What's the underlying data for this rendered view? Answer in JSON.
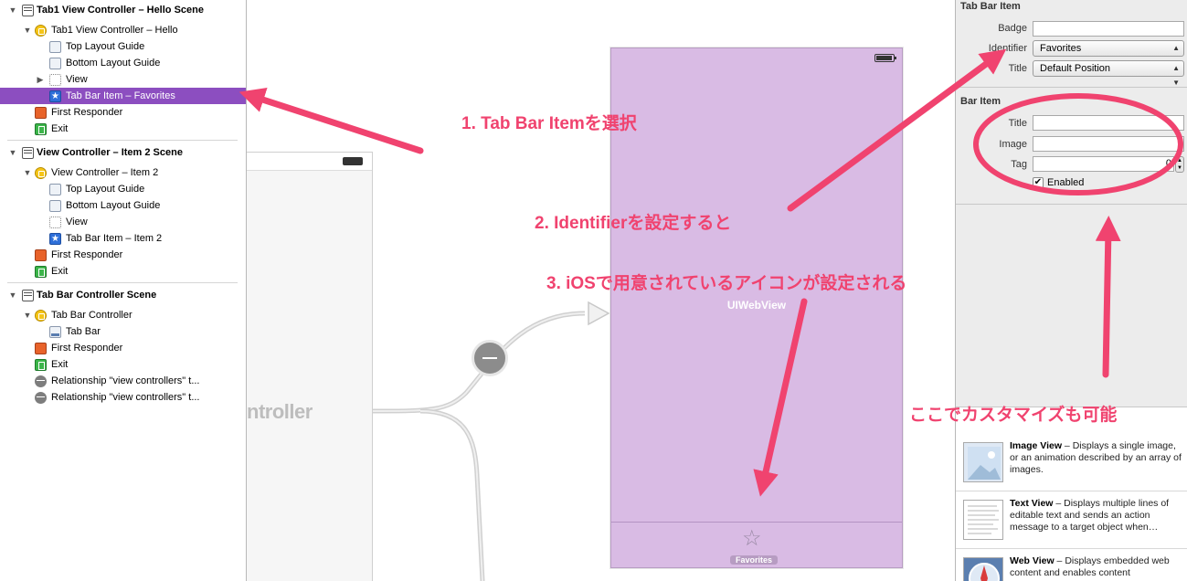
{
  "outline": {
    "items": [
      {
        "label": "Tab1 View Controller – Hello Scene",
        "icon": "scene-icon"
      },
      {
        "label": "Tab1 View Controller – Hello",
        "icon": "view-controller-icon"
      },
      {
        "label": "Top Layout Guide",
        "icon": "layout-guide-icon"
      },
      {
        "label": "Bottom Layout Guide",
        "icon": "layout-guide-icon"
      },
      {
        "label": "View",
        "icon": "view-icon"
      },
      {
        "label": "Tab Bar Item – Favorites",
        "icon": "tab-bar-item-icon"
      },
      {
        "label": "First Responder",
        "icon": "first-responder-icon"
      },
      {
        "label": "Exit",
        "icon": "exit-icon"
      },
      {
        "label": "View Controller – Item 2 Scene",
        "icon": "scene-icon"
      },
      {
        "label": "View Controller – Item 2",
        "icon": "view-controller-icon"
      },
      {
        "label": "Top Layout Guide",
        "icon": "layout-guide-icon"
      },
      {
        "label": "Bottom Layout Guide",
        "icon": "layout-guide-icon"
      },
      {
        "label": "View",
        "icon": "view-icon"
      },
      {
        "label": "Tab Bar Item – Item 2",
        "icon": "tab-bar-item-icon"
      },
      {
        "label": "First Responder",
        "icon": "first-responder-icon"
      },
      {
        "label": "Exit",
        "icon": "exit-icon"
      },
      {
        "label": "Tab Bar Controller Scene",
        "icon": "scene-icon"
      },
      {
        "label": "Tab Bar Controller",
        "icon": "view-controller-icon"
      },
      {
        "label": "Tab Bar",
        "icon": "tab-bar-icon"
      },
      {
        "label": "First Responder",
        "icon": "first-responder-icon"
      },
      {
        "label": "Exit",
        "icon": "exit-icon"
      },
      {
        "label": "Relationship \"view controllers\" t...",
        "icon": "relationship-icon"
      },
      {
        "label": "Relationship \"view controllers\" t...",
        "icon": "relationship-icon"
      }
    ],
    "selected_color": "#8c4ec0"
  },
  "canvas": {
    "bg_controller_label": "ntroller",
    "webview_label": "UIWebView",
    "tab_item_label": "Favorites",
    "phone_color": "#d9bbe4"
  },
  "inspector": {
    "tab_bar_item": {
      "title": "Tab Bar Item",
      "badge_label": "Badge",
      "badge_value": "",
      "identifier_label": "Identifier",
      "identifier_value": "Favorites",
      "title_label": "Title",
      "title_value": "Default Position"
    },
    "bar_item": {
      "title": "Bar Item",
      "title_label": "Title",
      "title_value": "",
      "image_label": "Image",
      "image_value": "",
      "tag_label": "Tag",
      "tag_value": "0",
      "enabled_label": "Enabled",
      "enabled_checked": true
    },
    "library": [
      {
        "name": "Image View",
        "desc": " – Displays a single image, or an animation described by an array of images."
      },
      {
        "name": "Text View",
        "desc": " – Displays multiple lines of editable text and sends an action message to a target object when…"
      },
      {
        "name": "Web View",
        "desc": " – Displays embedded web content and enables content"
      }
    ]
  },
  "annotations": {
    "step1": "1. Tab Bar Itemを選択",
    "step2": "2. Identifierを設定すると",
    "step3": "3. iOSで用意されているアイコンが設定される",
    "customize": "ここでカスタマイズも可能",
    "color": "#f0436f"
  }
}
